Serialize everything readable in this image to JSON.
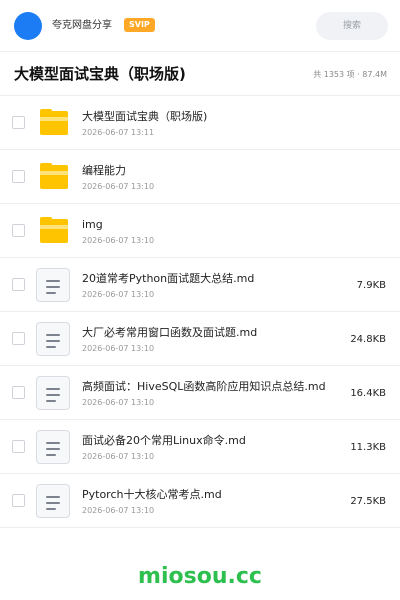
{
  "header": {
    "brand": "夸克网盘分享",
    "badge": "SVIP",
    "search_label": "搜索"
  },
  "folder": {
    "title": "大模型面试宝典（职场版)",
    "summary": "共 1353 项 · 87.4M"
  },
  "files": [
    {
      "type": "folder",
      "name": "大模型面试宝典（职场版)",
      "date": "2026-06-07 13:11",
      "size": ""
    },
    {
      "type": "folder",
      "name": "编程能力",
      "date": "2026-06-07 13:10",
      "size": ""
    },
    {
      "type": "folder",
      "name": "img",
      "date": "2026-06-07 13:10",
      "size": ""
    },
    {
      "type": "doc",
      "name": "20道常考Python面试题大总结.md",
      "date": "2026-06-07 13:10",
      "size": "7.9KB"
    },
    {
      "type": "doc",
      "name": "大厂必考常用窗口函数及面试题.md",
      "date": "2026-06-07 13:10",
      "size": "24.8KB"
    },
    {
      "type": "doc",
      "name": "高频面试：HiveSQL函数高阶应用知识点总结.md",
      "date": "2026-06-07 13:10",
      "size": "16.4KB"
    },
    {
      "type": "doc",
      "name": "面试必备20个常用Linux命令.md",
      "date": "2026-06-07 13:10",
      "size": "11.3KB"
    },
    {
      "type": "doc",
      "name": "Pytorch十大核心常考点.md",
      "date": "2026-06-07 13:10",
      "size": "27.5KB"
    }
  ],
  "watermark": "miosou.cc"
}
